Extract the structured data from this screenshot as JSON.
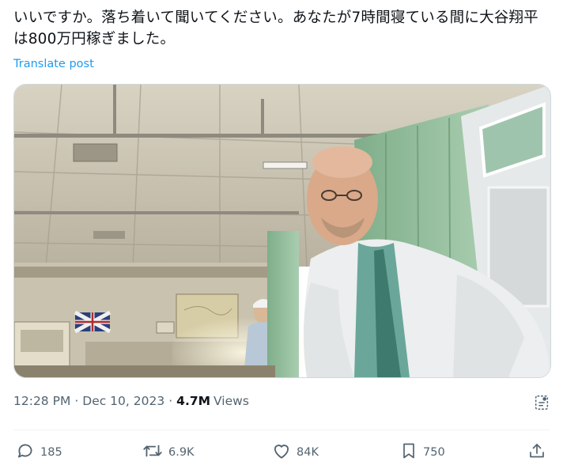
{
  "post": {
    "text": "いいですか。落ち着いて聞いてください。あなたが7時間寝ている間に大谷翔平は800万円稼ぎました。",
    "translate_label": "Translate post",
    "time": "12:28 PM",
    "date": "Dec 10, 2023",
    "views_count": "4.7M",
    "views_label": "Views"
  },
  "actions": {
    "replies": "185",
    "reposts": "6.9K",
    "likes": "84K",
    "bookmarks": "750"
  },
  "colors": {
    "link": "#1d9bf0",
    "secondary_text": "#536471",
    "primary_text": "#0f1419"
  },
  "icons": [
    "reply-icon",
    "repost-icon",
    "like-icon",
    "bookmark-icon",
    "share-icon",
    "analytics-icon"
  ]
}
